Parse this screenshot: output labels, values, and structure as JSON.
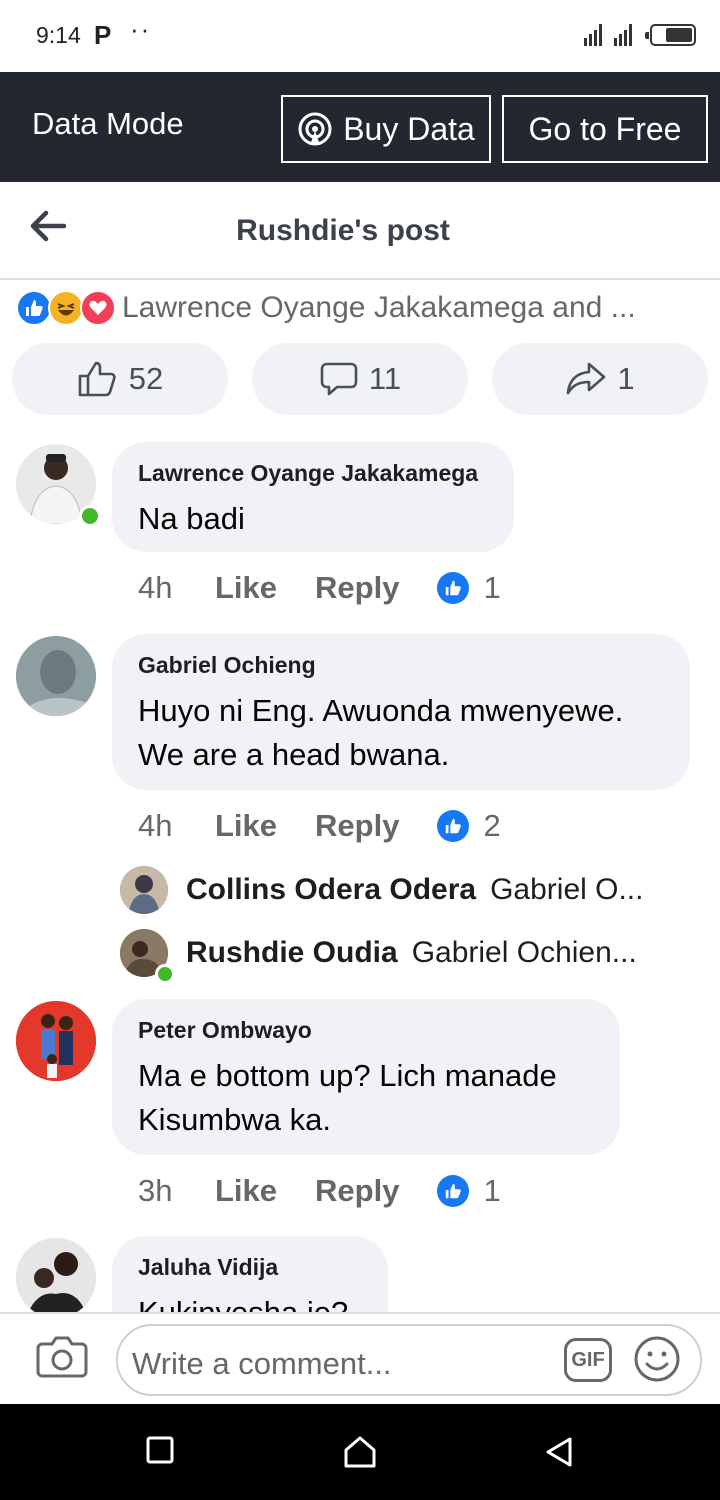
{
  "status_bar": {
    "time": "9:14",
    "notification_icon": "P",
    "dots": "··"
  },
  "data_bar": {
    "label": "Data Mode",
    "buy_label": "Buy Data",
    "free_label": "Go to Free"
  },
  "header": {
    "title": "Rushdie's post"
  },
  "reactions": {
    "names": "Lawrence Oyange Jakakamega and ...",
    "icons": [
      "like",
      "haha",
      "love"
    ]
  },
  "counters": {
    "likes": "52",
    "comments": "11",
    "shares": "1"
  },
  "comments": [
    {
      "name": "Lawrence Oyange Jakakamega",
      "text": "Na badi",
      "ago": "4h",
      "like": "Like",
      "reply": "Reply",
      "likes": "1",
      "online": true
    },
    {
      "name": "Gabriel Ochieng",
      "text": "Huyo ni Eng. Awuonda mwenyewe. We are a head bwana.",
      "ago": "4h",
      "like": "Like",
      "reply": "Reply",
      "likes": "2",
      "online": false,
      "replies": [
        {
          "name": "Collins Odera Odera",
          "text": "Gabriel O...",
          "online": false
        },
        {
          "name": "Rushdie Oudia",
          "text": "Gabriel Ochien...",
          "online": true
        }
      ]
    },
    {
      "name": "Peter Ombwayo",
      "text": "Ma e bottom up? Lich manade Kisumbwa ka.",
      "ago": "3h",
      "like": "Like",
      "reply": "Reply",
      "likes": "1",
      "online": false
    },
    {
      "name": "Jaluha Vidija",
      "text": "Kukinyesha je?",
      "online": false
    }
  ],
  "composer": {
    "placeholder": "Write a comment...",
    "gif_label": "GIF"
  },
  "colors": {
    "accent": "#1877f2",
    "online": "#42b72a",
    "bubble": "#f0f2f5",
    "data_bar": "#232830"
  }
}
